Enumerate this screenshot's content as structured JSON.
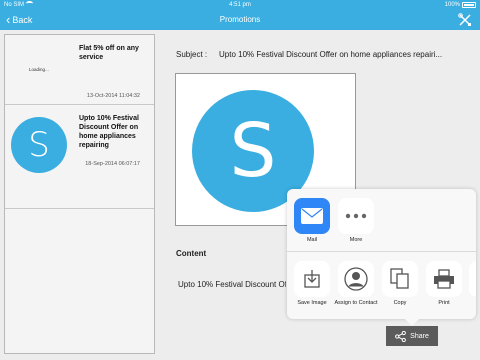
{
  "statusbar": {
    "carrier": "No SIM",
    "time": "4:51 pm",
    "battery": "100%"
  },
  "navbar": {
    "back_label": "Back",
    "title": "Promotions"
  },
  "list": {
    "items": [
      {
        "title": "Flat 5% off on any service",
        "date": "13-Oct-2014 11:04:32",
        "thumb_status": "Loading..."
      },
      {
        "title": "Upto 10% Festival Discount Offer on home appliances repairing",
        "date": "18-Sep-2014 06:07:17",
        "thumb_letter": "S"
      }
    ]
  },
  "detail": {
    "subject_label": "Subject :",
    "subject_value": "Upto 10% Festival Discount Offer on home appliances repairi...",
    "image_letter": "S",
    "content_label": "Content",
    "content_text": "Upto 10% Festival Discount Offer on home appliances repairing"
  },
  "share_sheet": {
    "row1": [
      {
        "label": "Mail",
        "icon": "mail-icon"
      },
      {
        "label": "More",
        "icon": "more-icon"
      }
    ],
    "row2": [
      {
        "label": "Save Image",
        "icon": "save-image-icon"
      },
      {
        "label": "Assign to Contact",
        "icon": "contact-icon"
      },
      {
        "label": "Copy",
        "icon": "copy-icon"
      },
      {
        "label": "Print",
        "icon": "print-icon"
      }
    ]
  },
  "share_button": {
    "label": "Share"
  },
  "colors": {
    "accent": "#3aaee0",
    "mail_blue": "#2f86f6",
    "share_bar": "#5b5b5b"
  }
}
